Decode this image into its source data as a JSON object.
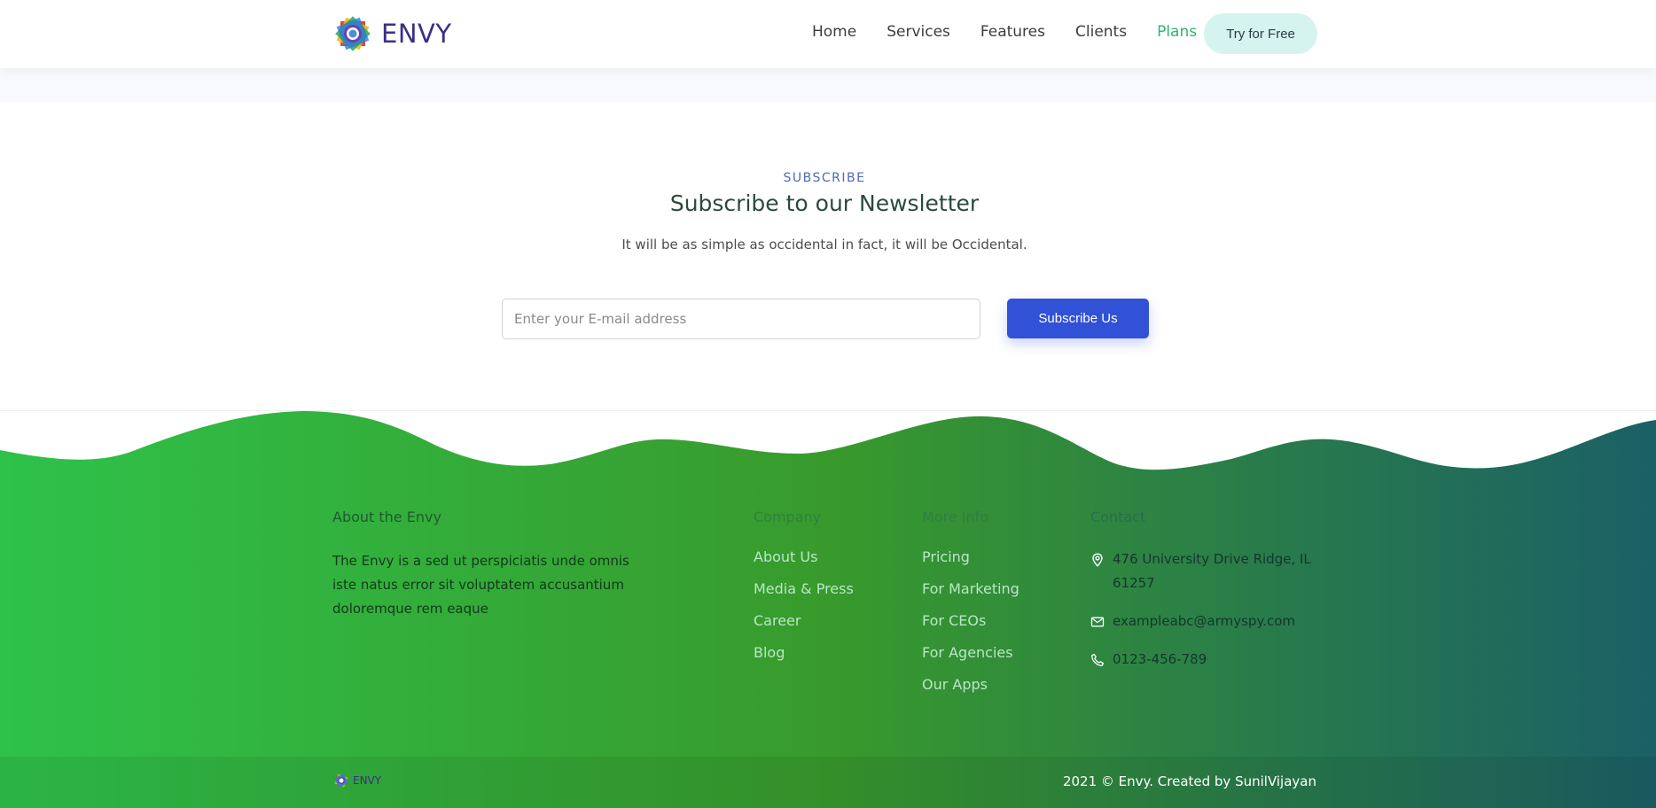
{
  "header": {
    "brand": "ENVY",
    "nav": [
      "Home",
      "Services",
      "Features",
      "Clients",
      "Plans"
    ],
    "active_nav": "Plans",
    "cta": "Try for Free"
  },
  "subscribe": {
    "kicker": "SUBSCRIBE",
    "title": "Subscribe to our Newsletter",
    "description": "It will be as simple as occidental in fact, it will be Occidental.",
    "email_placeholder": "Enter your E-mail address",
    "email_value": "",
    "button": "Subscribe Us"
  },
  "footer": {
    "about": {
      "heading": "About the Envy",
      "text": "The Envy is a sed ut perspiciatis unde omnis iste natus error sit voluptatem accusantium doloremque rem eaque"
    },
    "company": {
      "heading": "Company",
      "links": [
        "About Us",
        "Media & Press",
        "Career",
        "Blog"
      ]
    },
    "more_info": {
      "heading": "More Info",
      "links": [
        "Pricing",
        "For Marketing",
        "For CEOs",
        "For Agencies",
        "Our Apps"
      ]
    },
    "contact": {
      "heading": "Contact",
      "address": "476 University Drive Ridge, IL 61257",
      "email": "exampleabc@armyspy.com",
      "phone": "0123-456-789",
      "icons": [
        "map-pin-icon",
        "mail-icon",
        "phone-icon"
      ]
    },
    "bottom": {
      "brand": "ENVY",
      "copyright": "2021 © Envy. Created by SunilVijayan"
    }
  },
  "colors": {
    "brand_text": "#3b2f86",
    "accent_green": "#30b46f",
    "subscribe_button": "#3151d6",
    "footer_gradient_start": "#2ec24a",
    "footer_gradient_mid": "#389a2c",
    "footer_gradient_end": "#1b6066"
  }
}
